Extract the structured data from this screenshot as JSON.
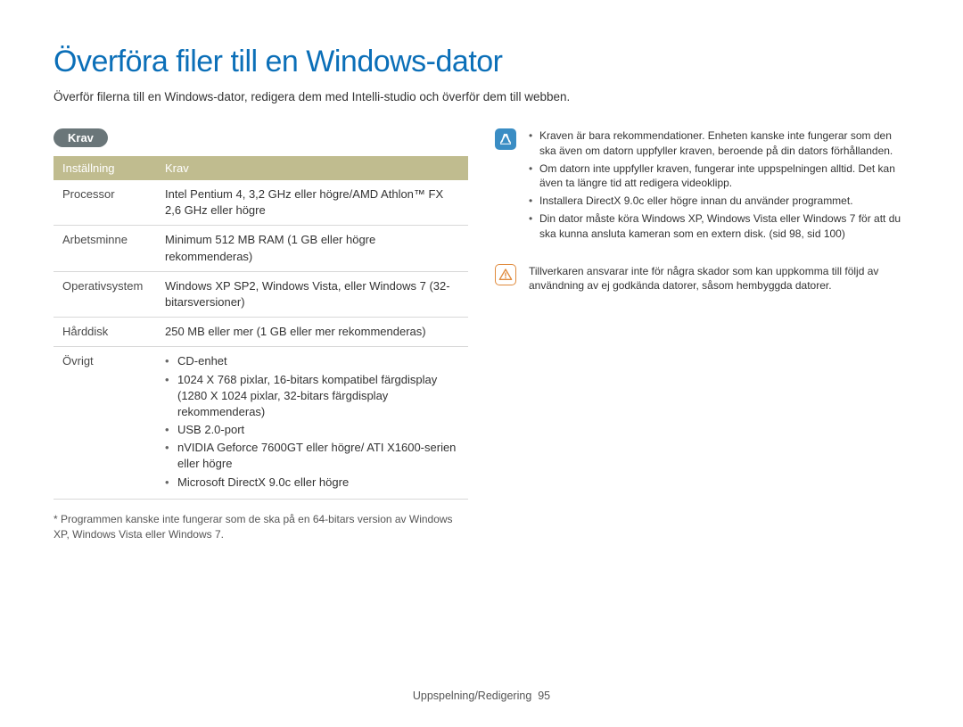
{
  "title": "Överföra filer till en Windows-dator",
  "intro": "Överför filerna till en Windows-dator, redigera dem med Intelli-studio och överför dem till webben.",
  "section_label": "Krav",
  "table": {
    "headers": {
      "setting": "Inställning",
      "req": "Krav"
    },
    "rows": [
      {
        "label": "Processor",
        "value": "Intel Pentium 4, 3,2 GHz eller högre/AMD Athlon™ FX 2,6 GHz eller högre"
      },
      {
        "label": "Arbetsminne",
        "value": "Minimum 512 MB RAM (1 GB eller högre rekommenderas)"
      },
      {
        "label": "Operativsystem",
        "value": "Windows XP SP2, Windows Vista, eller Windows 7 (32-bitarsversioner)"
      },
      {
        "label": "Hårddisk",
        "value": "250 MB eller mer (1 GB eller mer rekommenderas)"
      }
    ],
    "other": {
      "label": "Övrigt",
      "items": [
        "CD-enhet",
        "1024 X 768 pixlar, 16-bitars kompatibel färgdisplay (1280 X 1024 pixlar, 32-bitars färgdisplay rekommenderas)",
        "USB 2.0-port",
        "nVIDIA Geforce 7600GT eller högre/ ATI X1600-serien eller högre",
        "Microsoft DirectX 9.0c eller högre"
      ]
    }
  },
  "footnote": "Programmen kanske inte fungerar som de ska på en 64-bitars version av Windows XP, Windows Vista eller Windows 7.",
  "note": {
    "items": [
      "Kraven är bara rekommendationer. Enheten kanske inte fungerar som den ska även om datorn uppfyller kraven, beroende på din dators förhållanden.",
      "Om datorn inte uppfyller kraven, fungerar inte uppspelningen alltid. Det kan även ta längre tid att redigera videoklipp.",
      "Installera DirectX 9.0c eller högre innan du använder programmet.",
      "Din dator måste köra Windows XP, Windows Vista eller Windows 7 för att du ska kunna ansluta kameran som en extern disk. (sid 98, sid 100)"
    ]
  },
  "warning": "Tillverkaren ansvarar inte för några skador som kan uppkomma till följd av användning av ej godkända datorer, såsom hembyggda datorer.",
  "footer": {
    "section": "Uppspelning/Redigering",
    "page": "95"
  }
}
